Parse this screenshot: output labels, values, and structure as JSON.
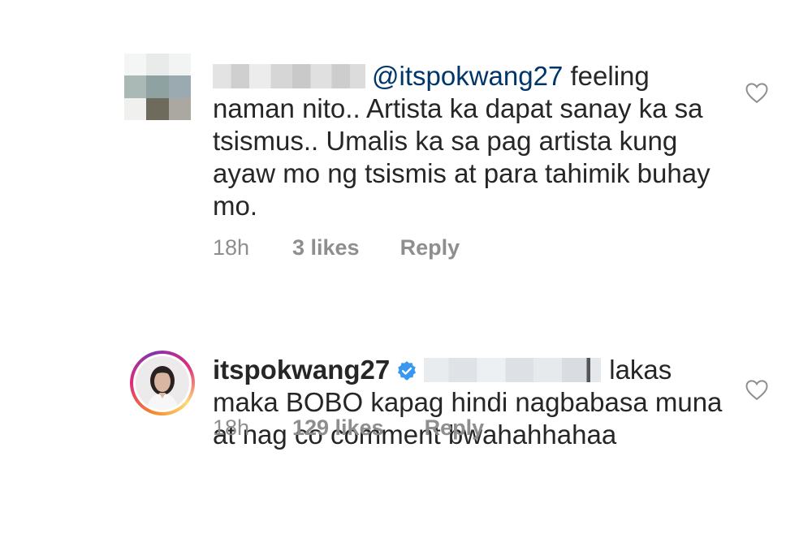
{
  "comments": [
    {
      "avatar": {
        "type": "pixelated",
        "colors": [
          "#f4f5f5",
          "#e9ebeb",
          "#f2f3f3",
          "#aab8b6",
          "#8ea3a1",
          "#9aaab0",
          "#f0f0ef",
          "#6e6a5c",
          "#aaa8a0"
        ]
      },
      "username_redacted": true,
      "mention": "@itspokwang27",
      "text": "feeling naman nito.. Artista ka dapat sanay ka sa tsismus.. Umalis ka sa pag artista kung ayaw mo ng tsismis at para tahimik buhay mo.",
      "time": "18h",
      "likes": "3 likes",
      "reply": "Reply",
      "icon": "heart-outline-icon"
    },
    {
      "avatar": {
        "type": "story-ring"
      },
      "username": "itspokwang27",
      "verified": true,
      "mention_redacted": true,
      "text": "lakas maka BOBO kapag hindi nagbabasa muna at nag co comment bwahahhahaa",
      "time": "18h",
      "likes": "129 likes",
      "reply": "Reply",
      "icon": "heart-outline-icon"
    }
  ],
  "colors": {
    "text": "#262626",
    "mention": "#003569",
    "meta": "#8e8e8e",
    "verified": "#3897f0"
  }
}
